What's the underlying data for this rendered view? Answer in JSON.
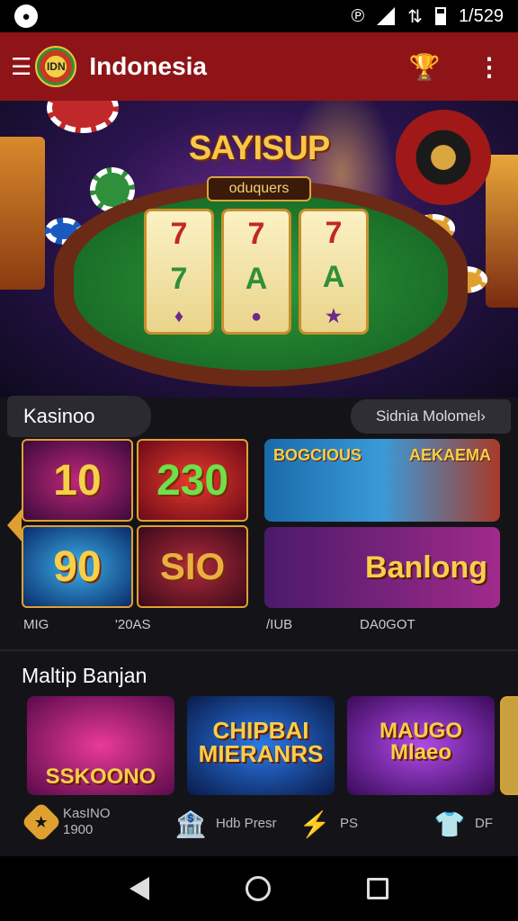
{
  "status_bar": {
    "time": "1/529",
    "icons": [
      "app-logo-icon",
      "vibrate-icon",
      "signal-icon",
      "data-icon",
      "battery-icon"
    ]
  },
  "app_bar": {
    "title": "Indonesia",
    "logo_text": "IDN",
    "menu_icon": "hamburger-icon",
    "trophy_icon": "trophy-icon",
    "more_icon": "more-vertical-icon"
  },
  "hero": {
    "title": "SAYISUP",
    "subtitle": "oduquers",
    "reels": [
      [
        "7",
        "7",
        "7"
      ],
      [
        "A",
        "7",
        "A"
      ],
      [
        "♦",
        "●",
        "★"
      ]
    ]
  },
  "section1": {
    "title": "Kasinoo",
    "more_label": "Sidnia Molomel›",
    "grid_tiles": [
      "10",
      "230",
      "90",
      "SIO"
    ],
    "card_top": {
      "left_text": "BOGCIOUS",
      "right_text": "AEKAEMA"
    },
    "card_bottom": {
      "text": "Banlong"
    },
    "captions": [
      "MIG",
      "'20AS",
      "/IUB",
      "DA0GOT"
    ]
  },
  "section2": {
    "title": "Maltip Banjan",
    "cards": [
      "SSKOONO",
      "CHIPBAI MIERANRS",
      "MAUGO Mlaeo"
    ]
  },
  "bottom_nav": [
    {
      "icon": "diamond-icon",
      "label_line1": "KasINO",
      "label_line2": "1900"
    },
    {
      "icon": "bank-icon",
      "label_line1": "Hdb Presr",
      "label_line2": ""
    },
    {
      "icon": "lightning-icon",
      "label_line1": "PS",
      "label_line2": ""
    },
    {
      "icon": "shirt-icon",
      "label_line1": "DF",
      "label_line2": ""
    }
  ],
  "colors": {
    "appbar": "#8e1418",
    "accent": "#e0a030",
    "background": "#141418"
  }
}
